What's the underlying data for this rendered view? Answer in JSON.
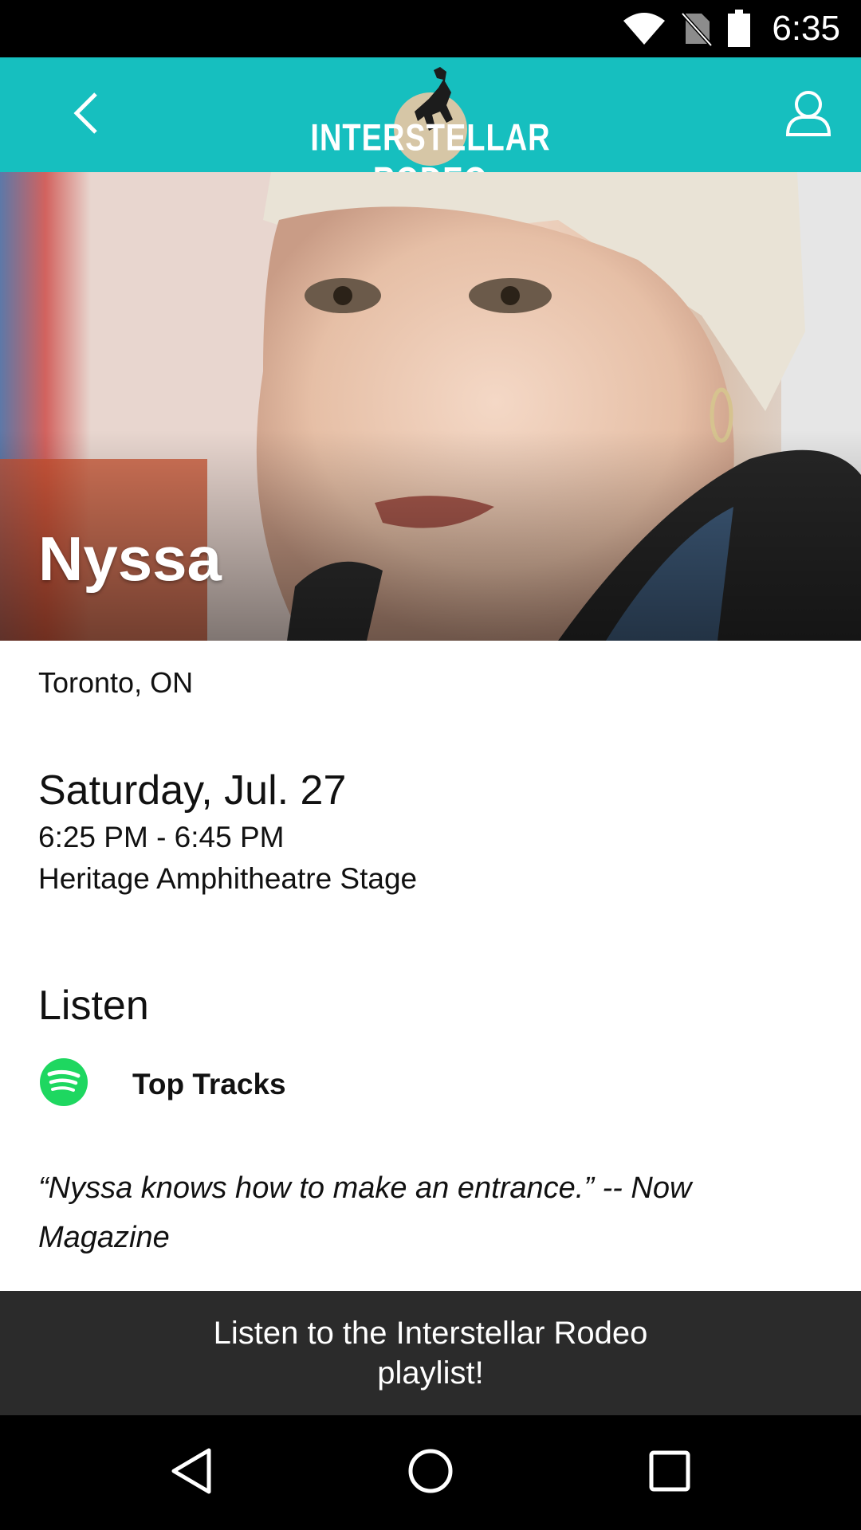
{
  "status_bar": {
    "time": "6:35",
    "icons": [
      "wifi-icon",
      "no-sim-icon",
      "battery-icon"
    ]
  },
  "header": {
    "logo_text": "Interstellar Rodeo",
    "back_icon": "chevron-left-icon",
    "profile_icon": "user-icon"
  },
  "artist": {
    "name": "Nyssa",
    "favorite_icon": "star-outline-icon",
    "location": "Toronto, ON",
    "date": "Saturday, Jul. 27",
    "time_range": "6:25 PM - 6:45 PM",
    "stage": "Heritage Amphitheatre Stage"
  },
  "listen": {
    "heading": "Listen",
    "spotify_label": "Top Tracks",
    "spotify_icon": "spotify-icon"
  },
  "quote": "“Nyssa knows how to make an entrance.” -- Now Magazine",
  "playlist_banner": "Listen to the Interstellar Rodeo playlist!",
  "nav": {
    "icons": [
      "back-triangle-icon",
      "home-circle-icon",
      "recents-square-icon"
    ]
  },
  "colors": {
    "header": "#16bfbf",
    "banner": "#2b2b2b",
    "spotify": "#1ed760"
  }
}
